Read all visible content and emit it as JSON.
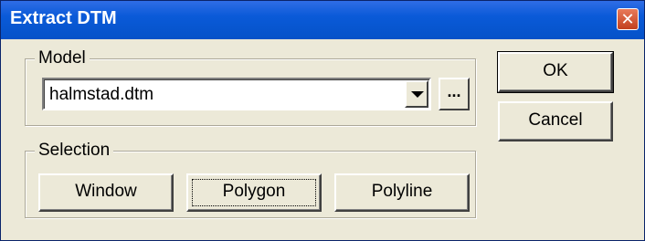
{
  "window": {
    "title": "Extract DTM",
    "close_icon": "close-icon"
  },
  "model": {
    "label": "Model",
    "combo_value": "halmstad.dtm",
    "browse_label": "..."
  },
  "selection": {
    "label": "Selection",
    "buttons": [
      "Window",
      "Polygon",
      "Polyline"
    ]
  },
  "actions": {
    "ok_label": "OK",
    "cancel_label": "Cancel"
  },
  "colors": {
    "titlebar": "#0a5ad8",
    "dialog_bg": "#ece9d8",
    "close_button": "#c2401f"
  }
}
